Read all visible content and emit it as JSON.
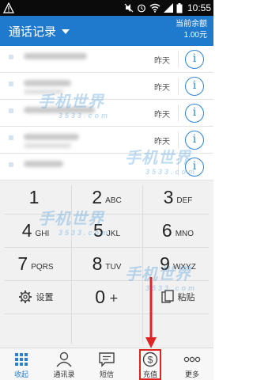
{
  "statusbar": {
    "time": "10:55",
    "icons": [
      "warning-icon",
      "mute-icon",
      "alarm-icon",
      "wifi-icon",
      "signal-icon",
      "battery-icon"
    ]
  },
  "header": {
    "title": "通话记录",
    "balance_label": "当前余额",
    "balance_amount": "1.00元"
  },
  "calllog": {
    "rows": [
      {
        "time": "昨天"
      },
      {
        "time": "昨天"
      },
      {
        "time": "昨天"
      },
      {
        "time": "昨天"
      },
      {
        "time": ""
      }
    ]
  },
  "dialpad": {
    "keys": [
      {
        "digit": "1",
        "letters": ""
      },
      {
        "digit": "2",
        "letters": "ABC"
      },
      {
        "digit": "3",
        "letters": "DEF"
      },
      {
        "digit": "4",
        "letters": "GHI"
      },
      {
        "digit": "5",
        "letters": "JKL"
      },
      {
        "digit": "6",
        "letters": "MNO"
      },
      {
        "digit": "7",
        "letters": "PQRS"
      },
      {
        "digit": "8",
        "letters": "TUV"
      },
      {
        "digit": "9",
        "letters": "WXYZ"
      }
    ],
    "settings_label": "设置",
    "zero_digit": "0",
    "zero_sub": "+",
    "paste_label": "粘贴"
  },
  "tabbar": {
    "tabs": [
      {
        "label": "收起",
        "icon": "dialpad-grid-icon"
      },
      {
        "label": "通讯录",
        "icon": "contacts-icon"
      },
      {
        "label": "短信",
        "icon": "sms-icon"
      },
      {
        "label": "充值",
        "icon": "recharge-icon"
      },
      {
        "label": "更多",
        "icon": "more-icon"
      }
    ]
  },
  "watermark": {
    "brand": "手机世界",
    "sub": "3533.com"
  },
  "colors": {
    "header_bg": "#1f79cc",
    "accent": "#2c83d8",
    "highlight": "#e02424"
  }
}
